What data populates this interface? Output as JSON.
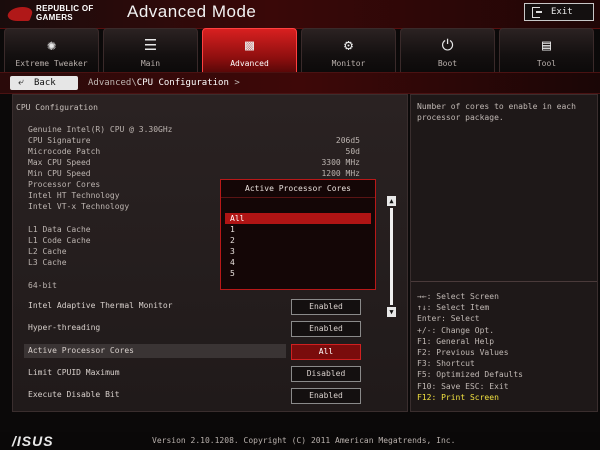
{
  "header": {
    "logo_lines": [
      "REPUBLIC OF",
      "GAMERS"
    ],
    "title": "Advanced Mode",
    "exit_label": "Exit",
    "exit_icon": "exit-door-icon"
  },
  "tabs": [
    {
      "label": "Extreme Tweaker",
      "icon": "fan-icon",
      "active": false
    },
    {
      "label": "Main",
      "icon": "list-icon",
      "active": false
    },
    {
      "label": "Advanced",
      "icon": "advanced-settings-icon",
      "active": true
    },
    {
      "label": "Monitor",
      "icon": "monitor-gauge-icon",
      "active": false
    },
    {
      "label": "Boot",
      "icon": "power-icon",
      "active": false
    },
    {
      "label": "Tool",
      "icon": "toolbox-icon",
      "active": false
    }
  ],
  "breadcrumb": {
    "back_label": "Back",
    "parent": "Advanced\\",
    "current": "CPU Configuration",
    "suffix": ">"
  },
  "main": {
    "section_title": "CPU Configuration",
    "info_rows": [
      {
        "label": "Genuine Intel(R) CPU @ 3.30GHz",
        "value": ""
      },
      {
        "label": "CPU Signature",
        "value": "206d5"
      },
      {
        "label": "Microcode Patch",
        "value": "50d"
      },
      {
        "label": "Max CPU Speed",
        "value": "3300 MHz"
      },
      {
        "label": "Min CPU Speed",
        "value": "1200 MHz"
      },
      {
        "label": "Processor Cores",
        "value": ""
      },
      {
        "label": "Intel HT Technology",
        "value": ""
      },
      {
        "label": "Intel VT-x Technology",
        "value": ""
      }
    ],
    "cache_rows": [
      {
        "label": "L1 Data Cache"
      },
      {
        "label": "L1 Code Cache"
      },
      {
        "label": "L2 Cache"
      },
      {
        "label": "L3 Cache"
      }
    ],
    "bits_label": "64-bit",
    "options": [
      {
        "label": "Intel Adaptive Thermal Monitor",
        "value": "Enabled"
      },
      {
        "label": "Hyper-threading",
        "value": "Enabled"
      },
      {
        "label": "Active Processor Cores",
        "value": "All",
        "selected": true
      },
      {
        "label": "Limit CPUID Maximum",
        "value": "Disabled"
      },
      {
        "label": "Execute Disable Bit",
        "value": "Enabled"
      }
    ]
  },
  "popup": {
    "title": "Active Processor Cores",
    "items": [
      "All",
      "1",
      "2",
      "3",
      "4",
      "5"
    ],
    "selected_index": 0
  },
  "help": {
    "text": "Number of cores to enable in each processor package.",
    "keys": [
      "→←: Select Screen",
      "↑↓: Select Item",
      "Enter: Select",
      "+/-: Change Opt.",
      "F1: General Help",
      "F2: Previous Values",
      "F3: Shortcut",
      "F5: Optimized Defaults",
      "F10: Save  ESC: Exit",
      "F12: Print Screen"
    ]
  },
  "footer": {
    "brand": "/ISUS",
    "version": "Version 2.10.1208. Copyright (C) 2011 American Megatrends, Inc."
  },
  "colors": {
    "accent_red": "#b01414",
    "highlight_yellow": "#f0e040"
  }
}
